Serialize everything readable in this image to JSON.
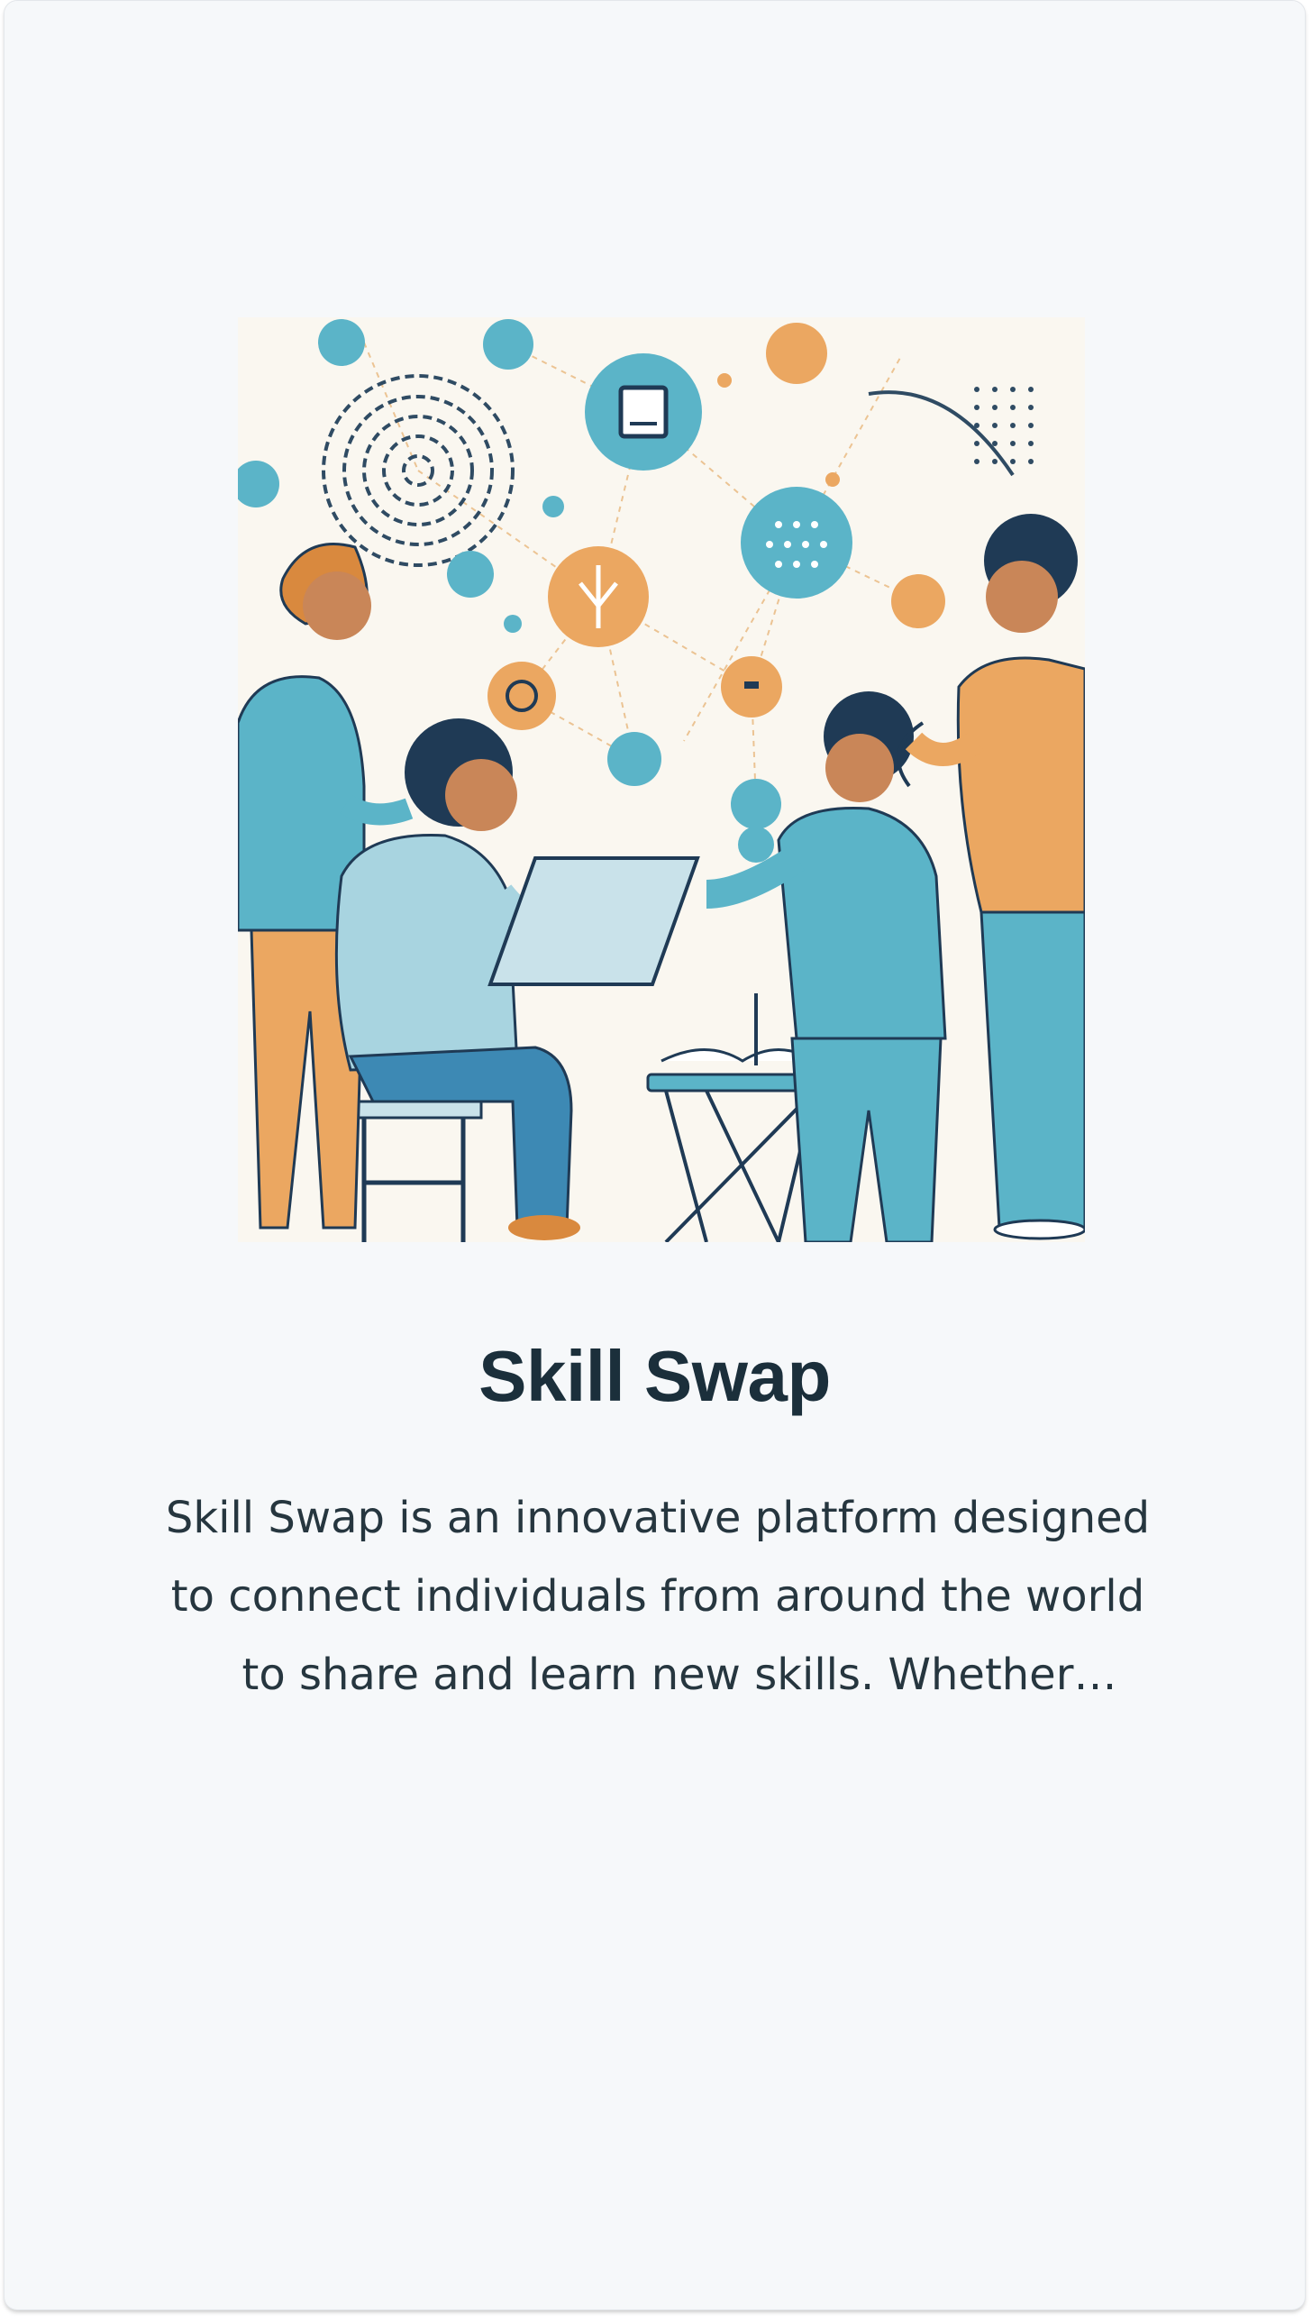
{
  "card": {
    "title": "Skill Swap",
    "description": "Skill Swap is an innovative platform designed to connect individuals from around the world to share and learn new skills. Whether you'r...",
    "image_subject": "people-sharing-skills-network-illustration"
  },
  "colors": {
    "card_background": "#f6f8fa",
    "title_text": "#1b2f3b",
    "body_text": "#26363f",
    "illustration_blue": "#5bb4c8",
    "illustration_orange": "#eba761",
    "illustration_navy": "#1f3a55"
  }
}
